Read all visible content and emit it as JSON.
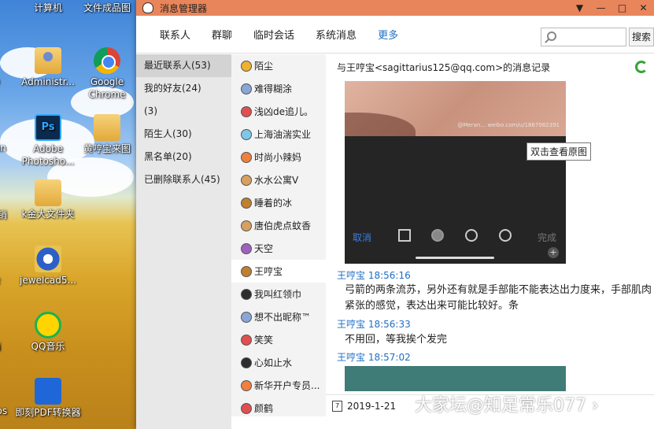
{
  "desktop": {
    "icons": [
      {
        "label": "接",
        "icon": "cut-off-icon"
      },
      {
        "label": "计算机",
        "icon": "computer-icon"
      },
      {
        "label": "文件成品图",
        "icon": "folder-icon"
      },
      {
        "label": "Q",
        "icon": "cut-off-icon"
      },
      {
        "label": "Administr...",
        "icon": "user-folder-icon"
      },
      {
        "label": "Google Chrome",
        "icon": "chrome-icon"
      },
      {
        "label": "can",
        "icon": "cut-off-icon"
      },
      {
        "label": "Adobe Photosho...",
        "icon": "photoshop-icon"
      },
      {
        "label": "黄哼宝来图",
        "icon": "folder-icon"
      },
      {
        "label": "品 销",
        "icon": "cut-off-icon"
      },
      {
        "label": "k金大文件夹",
        "icon": "folder-icon"
      },
      {
        "label": "合",
        "icon": "cut-off-icon"
      },
      {
        "label": "jewelcad5...",
        "icon": "jewelcad-icon"
      },
      {
        "label": "箱",
        "icon": "cut-off-icon"
      },
      {
        "label": "QQ音乐",
        "icon": "qqmusic-icon"
      },
      {
        "label": "ros",
        "icon": "cut-off-icon"
      },
      {
        "label": "即刻PDF转换器",
        "icon": "pdf-converter-icon"
      }
    ]
  },
  "window": {
    "title": "消息管理器",
    "controls": {
      "dropdown": "▼",
      "minimize": "—",
      "maximize": "□",
      "close": "✕"
    },
    "menu": [
      "联系人",
      "群聊",
      "临时会话",
      "系统消息",
      "更多"
    ],
    "search_button": "搜索"
  },
  "categories": [
    {
      "label": "最近联系人(53)",
      "selected": true
    },
    {
      "label": "我的好友(24)",
      "selected": false
    },
    {
      "label": "(3)",
      "selected": false
    },
    {
      "label": "陌生人(30)",
      "selected": false
    },
    {
      "label": "黑名单(20)",
      "selected": false
    },
    {
      "label": "已删除联系人(45)",
      "selected": false
    }
  ],
  "contacts": [
    {
      "name": "陌尘",
      "avatar": "a1"
    },
    {
      "name": "难得糊涂",
      "avatar": "a2"
    },
    {
      "name": "浅凶de追儿。",
      "avatar": "a3"
    },
    {
      "name": "上海油湍实业",
      "avatar": "a4"
    },
    {
      "name": "时尚小辣妈",
      "avatar": "a5"
    },
    {
      "name": "水水公寓V",
      "avatar": "a6"
    },
    {
      "name": "睡着的冰",
      "avatar": "a8"
    },
    {
      "name": "唐伯虎点蚊香",
      "avatar": "a6"
    },
    {
      "name": "天空",
      "avatar": "a7"
    },
    {
      "name": "王哼宝",
      "avatar": "a8",
      "selected": true
    },
    {
      "name": "我叫红领巾",
      "avatar": "a9"
    },
    {
      "name": "想不出昵称™",
      "avatar": "a2"
    },
    {
      "name": "笑笑",
      "avatar": "a3"
    },
    {
      "name": "心如止水",
      "avatar": "a9"
    },
    {
      "name": "新华开户专员...",
      "avatar": "a5"
    },
    {
      "name": "颜鹤",
      "avatar": "a3"
    }
  ],
  "record": {
    "title": "与王哼宝<sagittarius125@qq.com>的消息记录",
    "image": {
      "watermark": "@Meran… weibo.com/u/1867082391",
      "cancel": "取消",
      "done": "完成",
      "plus": "+"
    },
    "tooltip": "双击查看原图",
    "messages": [
      {
        "sender": "王哼宝",
        "time": "18:56:16",
        "text": "弓箭的两条流苏，另外还有就是手部能不能表达出力度来，手部肌肉紧张的感觉，表达出来可能比较好。条"
      },
      {
        "sender": "王哼宝",
        "time": "18:56:33",
        "text": "不用回，等我挨个发完"
      },
      {
        "sender": "王哼宝",
        "time": "18:57:02",
        "text": ""
      }
    ],
    "date_icon": "7",
    "date": "2019-1-21"
  },
  "watermark_text": "大家坛@知足常乐077 ›"
}
